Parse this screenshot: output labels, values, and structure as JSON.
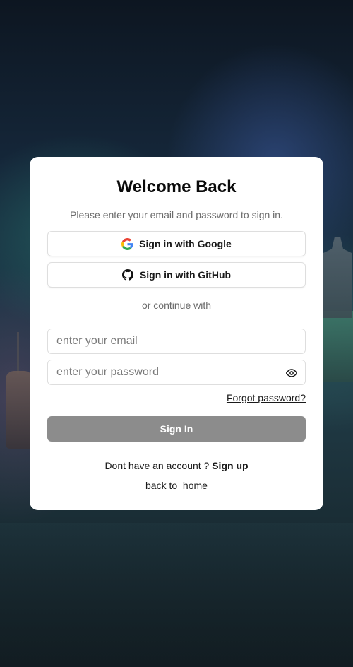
{
  "header": {
    "title": "Welcome Back",
    "subtitle": "Please enter your email and password to sign in."
  },
  "oauth": {
    "google_label": "Sign in with Google",
    "github_label": "Sign in with GitHub",
    "divider": "or continue with"
  },
  "form": {
    "email_placeholder": "enter your email",
    "email_value": "",
    "password_placeholder": "enter your password",
    "password_value": "",
    "forgot_label": "Forgot password?",
    "submit_label": "Sign In"
  },
  "footer": {
    "signup_prompt": "Dont have an account ? ",
    "signup_link": "Sign up",
    "home_prompt": "back to ",
    "home_link": " home"
  },
  "icons": {
    "google": "google-icon",
    "github": "github-icon",
    "password_toggle": "eye-icon"
  },
  "colors": {
    "card_bg": "#ffffff",
    "submit_bg": "#8c8c8c",
    "text": "#1a1a1a",
    "muted": "#6b6b6b"
  }
}
